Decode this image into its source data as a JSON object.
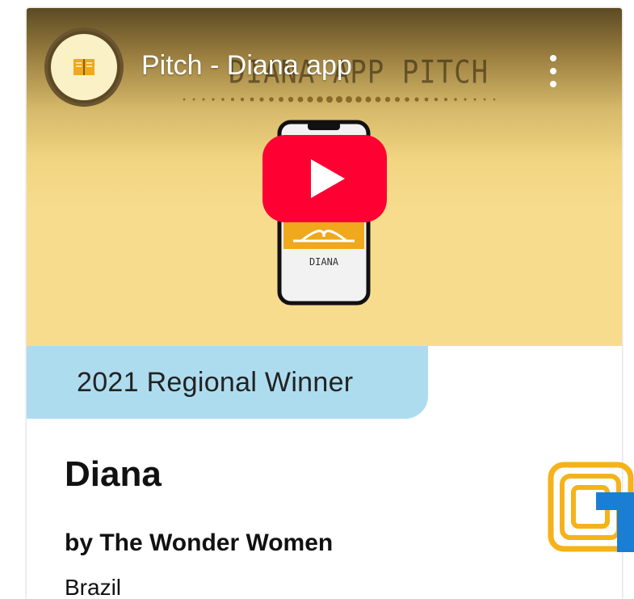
{
  "video": {
    "channel_icon": "open-book-icon",
    "title": "Pitch - Diana app",
    "overlay_text": "DIANA APP PITCH",
    "phone_label": "DIANA",
    "menu_icon": "kebab-menu-icon",
    "play_icon": "youtube-play-icon"
  },
  "badge": {
    "label": "2021 Regional Winner"
  },
  "project": {
    "title": "Diana",
    "team": "by The Wonder Women",
    "country": "Brazil"
  },
  "colors": {
    "badge_bg": "#aedcef",
    "play_red": "#ff0033",
    "video_bg": "#f8dc8e",
    "logo_orange": "#f5b21a",
    "logo_blue": "#1a7fd4"
  }
}
